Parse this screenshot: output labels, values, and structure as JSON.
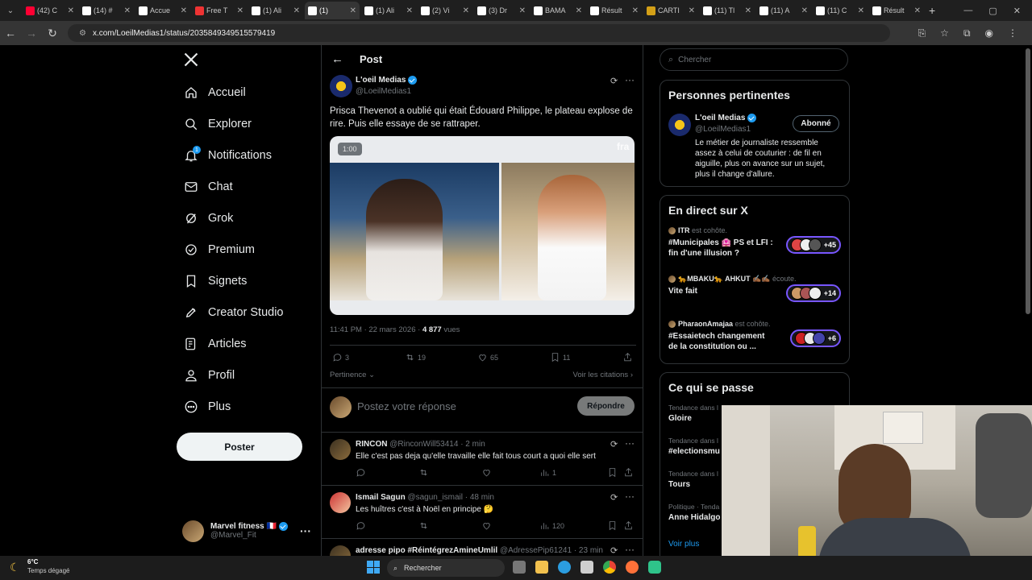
{
  "browser": {
    "tabs": [
      {
        "label": "(42) C",
        "icon": "youtube-icon",
        "color": "#ff0033"
      },
      {
        "label": "(14) #",
        "icon": "x-logo-icon",
        "color": "#ffffff"
      },
      {
        "label": "Accue",
        "icon": "x-logo-icon",
        "color": "#ffffff"
      },
      {
        "label": "Free T",
        "icon": "flag-icon",
        "color": "#e33"
      },
      {
        "label": "(1) Ali",
        "icon": "x-logo-icon",
        "color": "#ffffff"
      },
      {
        "label": "(1)",
        "icon": "x-logo-icon",
        "color": "#ffffff"
      },
      {
        "label": "(1) Ali",
        "icon": "x-logo-icon",
        "color": "#ffffff"
      },
      {
        "label": "(2) Vi",
        "icon": "x-logo-icon",
        "color": "#ffffff"
      },
      {
        "label": "(3) Dr",
        "icon": "x-logo-icon",
        "color": "#ffffff"
      },
      {
        "label": "BAMA",
        "icon": "x-logo-icon",
        "color": "#ffffff"
      },
      {
        "label": "Résult",
        "icon": "doc-icon",
        "color": "#ffffff"
      },
      {
        "label": "CARTI",
        "icon": "bookmark-icon",
        "color": "#d4a017"
      },
      {
        "label": "(11) Tl",
        "icon": "x-logo-icon",
        "color": "#ffffff"
      },
      {
        "label": "(11) A",
        "icon": "x-logo-icon",
        "color": "#ffffff"
      },
      {
        "label": "(11) C",
        "icon": "x-logo-icon",
        "color": "#ffffff"
      },
      {
        "label": "Résult",
        "icon": "doc-icon",
        "color": "#ffffff"
      }
    ],
    "active_tab_index": 5,
    "new_tab": "+",
    "url": "x.com/LoeilMedias1/status/2035849349515579419"
  },
  "nav": {
    "items": [
      {
        "label": "Accueil",
        "icon": "home-icon"
      },
      {
        "label": "Explorer",
        "icon": "search-icon"
      },
      {
        "label": "Notifications",
        "icon": "bell-icon",
        "badge": "1"
      },
      {
        "label": "Chat",
        "icon": "mail-icon"
      },
      {
        "label": "Grok",
        "icon": "grok-icon"
      },
      {
        "label": "Premium",
        "icon": "premium-icon"
      },
      {
        "label": "Signets",
        "icon": "bookmark-icon"
      },
      {
        "label": "Creator Studio",
        "icon": "rocket-icon"
      },
      {
        "label": "Articles",
        "icon": "articles-icon"
      },
      {
        "label": "Profil",
        "icon": "user-icon"
      },
      {
        "label": "Plus",
        "icon": "more-circle-icon"
      }
    ],
    "post_button": "Poster",
    "account": {
      "name": "Marvel fitness 🇫🇷",
      "handle": "@Marvel_Fit"
    }
  },
  "post": {
    "header": "Post",
    "author": "L'oeil Medias",
    "handle": "@LoeilMedias1",
    "text": "Prisca Thevenot a oublié qui était Édouard Philippe, le plateau explose de rire. Puis elle essaye de se rattraper.",
    "video_time": "1:00",
    "video_watermark": "fra",
    "timestamp": "11:41 PM · 22 mars 2026 · ",
    "views_count": "4 877",
    "views_label": " vues",
    "stats": {
      "replies": "3",
      "reposts": "19",
      "likes": "65",
      "bookmarks": "11"
    },
    "sort_label": "Pertinence",
    "quotes_link": "Voir les citations",
    "reply_placeholder": "Postez votre réponse",
    "reply_button": "Répondre"
  },
  "replies": [
    {
      "name": "RINCON",
      "handle": "@RinconWill53414 · 2 min",
      "text": "Elle c'est pas deja qu'elle travaille elle fait tous court a quoi elle sert",
      "views": "1"
    },
    {
      "name": "Ismail Sagun",
      "handle": "@sagun_ismail · 48 min",
      "text": "Les huîtres c'est à Noël en principe 🤔",
      "views": "120"
    },
    {
      "name": "adresse pipo #RéintégrezAmineUmlil",
      "handle": "@AdressePip61241 · 23 min",
      "text": "",
      "views": ""
    }
  ],
  "sidebar": {
    "search_placeholder": "Chercher",
    "relevant": {
      "title": "Personnes pertinentes",
      "name": "L'oeil Medias",
      "handle": "@LoeilMedias1",
      "follow_label": "Abonné",
      "bio": "Le métier de journaliste ressemble assez à celui de couturier : de fil en aiguille, plus on avance sur un sujet, plus il change d'allure."
    },
    "live": {
      "title": "En direct sur X",
      "items": [
        {
          "host": "ITR",
          "status": " est cohôte.",
          "title": "#Municipales 🏩 PS et LFI : fin d'une illusion ?",
          "count": "+45"
        },
        {
          "host": "🐆MBAKU🐆 AHKUT ✍🏾✍🏾",
          "status": " écoute.",
          "title": "Vite fait",
          "count": "+14"
        },
        {
          "host": "PharaonAmajaa",
          "status": " est cohôte.",
          "title": "#Essaietech changement de la constitution ou ...",
          "count": "+6"
        }
      ]
    },
    "trends": {
      "title": "Ce qui se passe",
      "items": [
        {
          "context": "Tendance dans l",
          "name": "Gloire"
        },
        {
          "context": "Tendance dans l",
          "name": "#electionsmu"
        },
        {
          "context": "Tendance dans l",
          "name": "Tours"
        },
        {
          "context": "Politique · Tenda",
          "name": "Anne Hidalgo"
        }
      ],
      "more": "Voir plus"
    }
  },
  "taskbar": {
    "weather_temp": "6°C",
    "weather_text": "Temps dégagé",
    "search_label": "Rechercher"
  },
  "colors": {
    "accent": "#1d9bf0",
    "live_border": "#7856ff"
  }
}
